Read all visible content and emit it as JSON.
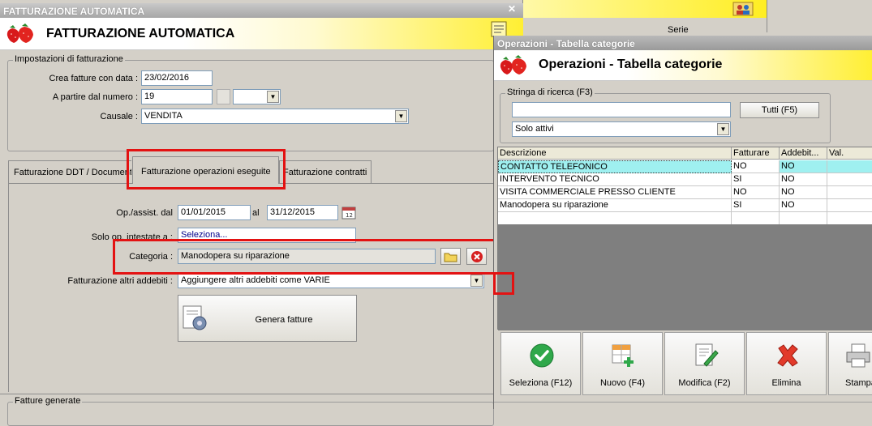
{
  "main": {
    "window_title": "FATTURAZIONE AUTOMATICA",
    "banner_title": "FATTURAZIONE AUTOMATICA",
    "settings_group_label": "Impostazioni di fatturazione",
    "date_label": "Crea fatture con data :",
    "date_value": "23/02/2016",
    "number_label": "A partire dal numero :",
    "number_value": "19",
    "causale_label": "Causale :",
    "causale_value": "VENDITA",
    "tabs": [
      {
        "label": "Fatturazione DDT / Documenti"
      },
      {
        "label": "Fatturazione operazioni eseguite"
      },
      {
        "label": "Fatturazione contratti"
      }
    ],
    "op_from_label": "Op./assist. dal",
    "op_from_value": "01/01/2015",
    "op_to_label": "al",
    "op_to_value": "31/12/2015",
    "solo_label": "Solo op. intestate a :",
    "solo_value": "Seleziona...",
    "categoria_label": "Categoria :",
    "categoria_value": "Manodopera su riparazione",
    "altri_label": "Fatturazione altri addebiti :",
    "altri_value": "Aggiungere altri addebiti come VARIE",
    "genera_label": "Genera fatture",
    "generated_group_label": "Fatture generate"
  },
  "background": {
    "serie_label": "Serie"
  },
  "ops": {
    "window_title": "Operazioni - Tabella categorie",
    "banner_title": "Operazioni - Tabella categorie",
    "search_group_label": "Stringa di ricerca (F3)",
    "search_value": "",
    "tutti_label": "Tutti (F5)",
    "filter_value": "Solo attivi",
    "columns": [
      "Descrizione",
      "Fatturare",
      "Addebit...",
      "Val."
    ],
    "rows": [
      {
        "descrizione": "CONTATTO TELEFONICO",
        "fatturare": "NO",
        "addebiti": "NO"
      },
      {
        "descrizione": "INTERVENTO TECNICO",
        "fatturare": "SI",
        "addebiti": "NO"
      },
      {
        "descrizione": "VISITA COMMERCIALE PRESSO CLIENTE",
        "fatturare": "NO",
        "addebiti": "NO"
      },
      {
        "descrizione": "Manodopera su riparazione",
        "fatturare": "SI",
        "addebiti": "NO"
      }
    ],
    "buttons": [
      {
        "label": "Seleziona (F12)",
        "icon": "check-icon"
      },
      {
        "label": "Nuovo (F4)",
        "icon": "new-grid-icon"
      },
      {
        "label": "Modifica (F2)",
        "icon": "edit-icon"
      },
      {
        "label": "Elimina",
        "icon": "delete-x-icon"
      },
      {
        "label": "Stampa",
        "icon": "printer-icon"
      }
    ]
  },
  "colors": {
    "highlight_red": "#e31212",
    "selected_row": "#9ff0f0",
    "banner_yellow": "#ffef33"
  }
}
